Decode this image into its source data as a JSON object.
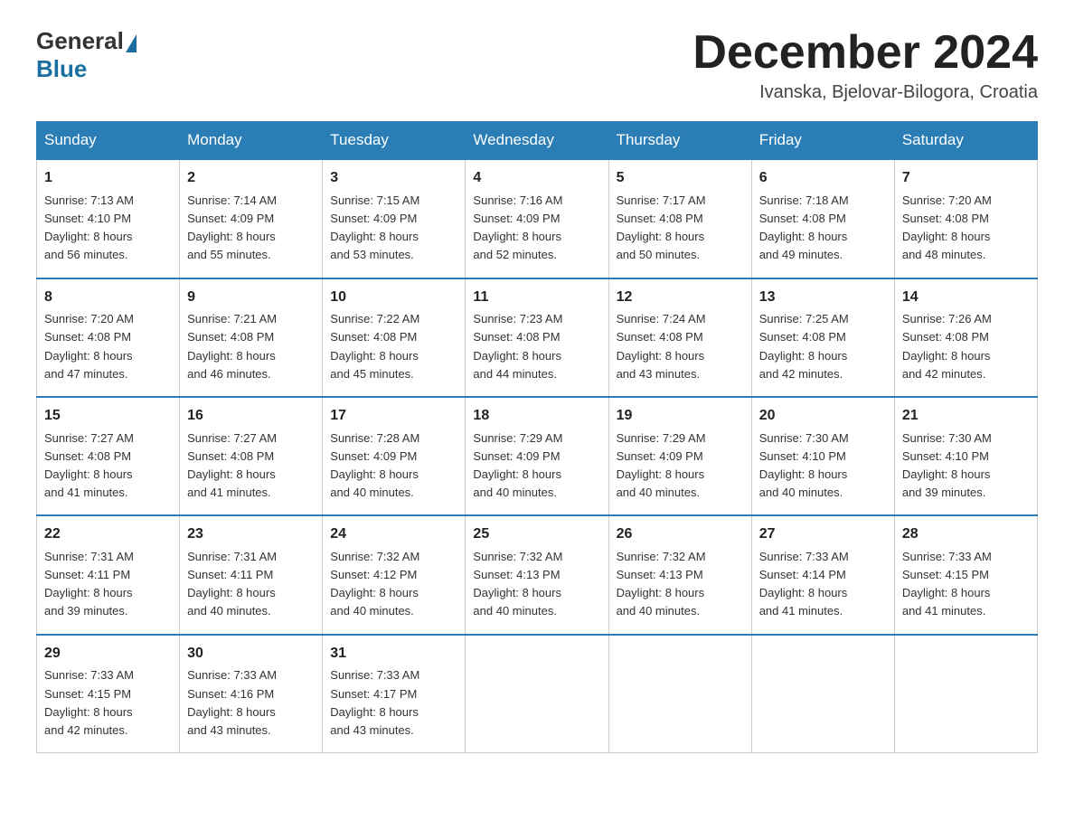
{
  "header": {
    "logo_general": "General",
    "logo_blue": "Blue",
    "month_title": "December 2024",
    "location": "Ivanska, Bjelovar-Bilogora, Croatia"
  },
  "days_of_week": [
    "Sunday",
    "Monday",
    "Tuesday",
    "Wednesday",
    "Thursday",
    "Friday",
    "Saturday"
  ],
  "weeks": [
    [
      {
        "day": "1",
        "sunrise": "7:13 AM",
        "sunset": "4:10 PM",
        "daylight": "8 hours and 56 minutes."
      },
      {
        "day": "2",
        "sunrise": "7:14 AM",
        "sunset": "4:09 PM",
        "daylight": "8 hours and 55 minutes."
      },
      {
        "day": "3",
        "sunrise": "7:15 AM",
        "sunset": "4:09 PM",
        "daylight": "8 hours and 53 minutes."
      },
      {
        "day": "4",
        "sunrise": "7:16 AM",
        "sunset": "4:09 PM",
        "daylight": "8 hours and 52 minutes."
      },
      {
        "day": "5",
        "sunrise": "7:17 AM",
        "sunset": "4:08 PM",
        "daylight": "8 hours and 50 minutes."
      },
      {
        "day": "6",
        "sunrise": "7:18 AM",
        "sunset": "4:08 PM",
        "daylight": "8 hours and 49 minutes."
      },
      {
        "day": "7",
        "sunrise": "7:20 AM",
        "sunset": "4:08 PM",
        "daylight": "8 hours and 48 minutes."
      }
    ],
    [
      {
        "day": "8",
        "sunrise": "7:20 AM",
        "sunset": "4:08 PM",
        "daylight": "8 hours and 47 minutes."
      },
      {
        "day": "9",
        "sunrise": "7:21 AM",
        "sunset": "4:08 PM",
        "daylight": "8 hours and 46 minutes."
      },
      {
        "day": "10",
        "sunrise": "7:22 AM",
        "sunset": "4:08 PM",
        "daylight": "8 hours and 45 minutes."
      },
      {
        "day": "11",
        "sunrise": "7:23 AM",
        "sunset": "4:08 PM",
        "daylight": "8 hours and 44 minutes."
      },
      {
        "day": "12",
        "sunrise": "7:24 AM",
        "sunset": "4:08 PM",
        "daylight": "8 hours and 43 minutes."
      },
      {
        "day": "13",
        "sunrise": "7:25 AM",
        "sunset": "4:08 PM",
        "daylight": "8 hours and 42 minutes."
      },
      {
        "day": "14",
        "sunrise": "7:26 AM",
        "sunset": "4:08 PM",
        "daylight": "8 hours and 42 minutes."
      }
    ],
    [
      {
        "day": "15",
        "sunrise": "7:27 AM",
        "sunset": "4:08 PM",
        "daylight": "8 hours and 41 minutes."
      },
      {
        "day": "16",
        "sunrise": "7:27 AM",
        "sunset": "4:08 PM",
        "daylight": "8 hours and 41 minutes."
      },
      {
        "day": "17",
        "sunrise": "7:28 AM",
        "sunset": "4:09 PM",
        "daylight": "8 hours and 40 minutes."
      },
      {
        "day": "18",
        "sunrise": "7:29 AM",
        "sunset": "4:09 PM",
        "daylight": "8 hours and 40 minutes."
      },
      {
        "day": "19",
        "sunrise": "7:29 AM",
        "sunset": "4:09 PM",
        "daylight": "8 hours and 40 minutes."
      },
      {
        "day": "20",
        "sunrise": "7:30 AM",
        "sunset": "4:10 PM",
        "daylight": "8 hours and 40 minutes."
      },
      {
        "day": "21",
        "sunrise": "7:30 AM",
        "sunset": "4:10 PM",
        "daylight": "8 hours and 39 minutes."
      }
    ],
    [
      {
        "day": "22",
        "sunrise": "7:31 AM",
        "sunset": "4:11 PM",
        "daylight": "8 hours and 39 minutes."
      },
      {
        "day": "23",
        "sunrise": "7:31 AM",
        "sunset": "4:11 PM",
        "daylight": "8 hours and 40 minutes."
      },
      {
        "day": "24",
        "sunrise": "7:32 AM",
        "sunset": "4:12 PM",
        "daylight": "8 hours and 40 minutes."
      },
      {
        "day": "25",
        "sunrise": "7:32 AM",
        "sunset": "4:13 PM",
        "daylight": "8 hours and 40 minutes."
      },
      {
        "day": "26",
        "sunrise": "7:32 AM",
        "sunset": "4:13 PM",
        "daylight": "8 hours and 40 minutes."
      },
      {
        "day": "27",
        "sunrise": "7:33 AM",
        "sunset": "4:14 PM",
        "daylight": "8 hours and 41 minutes."
      },
      {
        "day": "28",
        "sunrise": "7:33 AM",
        "sunset": "4:15 PM",
        "daylight": "8 hours and 41 minutes."
      }
    ],
    [
      {
        "day": "29",
        "sunrise": "7:33 AM",
        "sunset": "4:15 PM",
        "daylight": "8 hours and 42 minutes."
      },
      {
        "day": "30",
        "sunrise": "7:33 AM",
        "sunset": "4:16 PM",
        "daylight": "8 hours and 43 minutes."
      },
      {
        "day": "31",
        "sunrise": "7:33 AM",
        "sunset": "4:17 PM",
        "daylight": "8 hours and 43 minutes."
      },
      {
        "day": "",
        "sunrise": "",
        "sunset": "",
        "daylight": ""
      },
      {
        "day": "",
        "sunrise": "",
        "sunset": "",
        "daylight": ""
      },
      {
        "day": "",
        "sunrise": "",
        "sunset": "",
        "daylight": ""
      },
      {
        "day": "",
        "sunrise": "",
        "sunset": "",
        "daylight": ""
      }
    ]
  ],
  "labels": {
    "sunrise": "Sunrise:",
    "sunset": "Sunset:",
    "daylight": "Daylight:"
  }
}
